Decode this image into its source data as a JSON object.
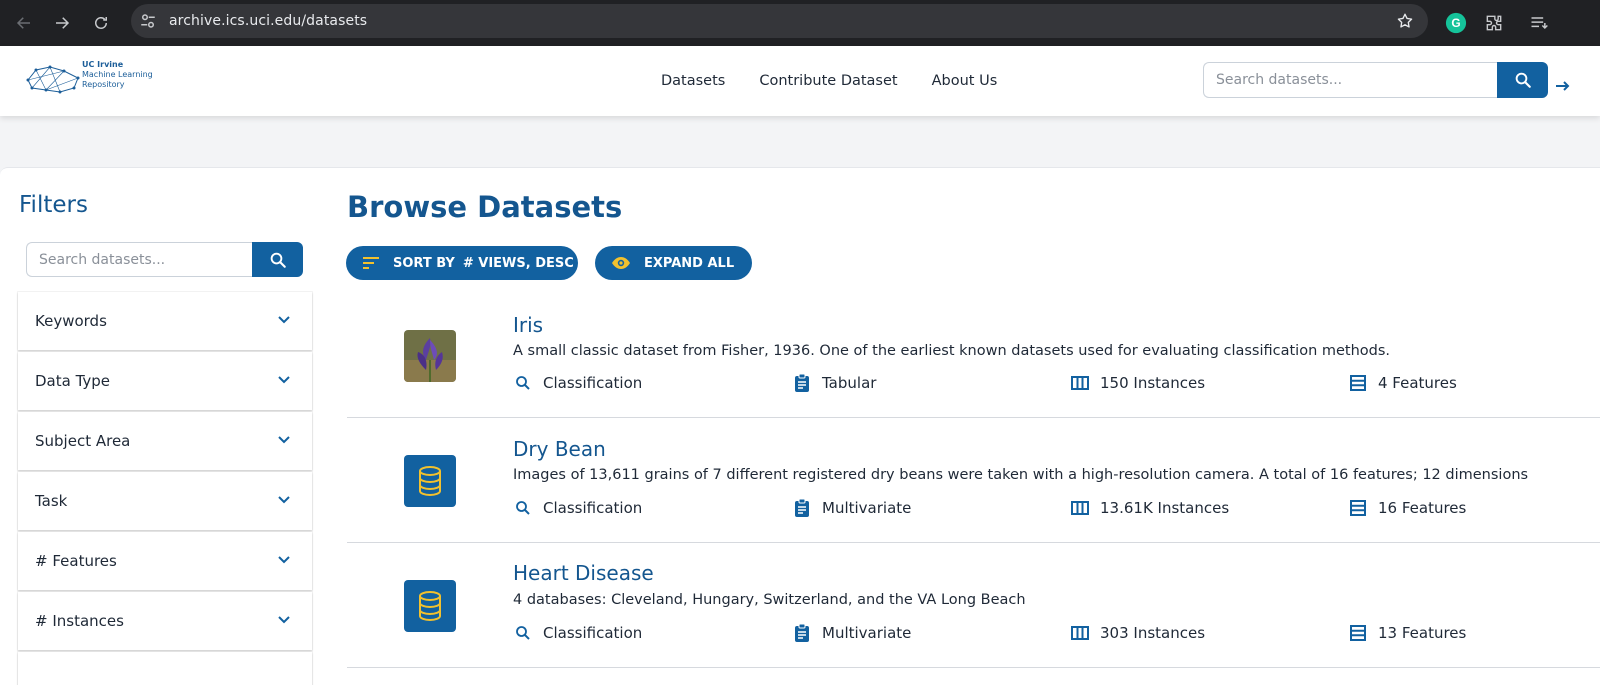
{
  "browser": {
    "url": "archive.ics.uci.edu/datasets"
  },
  "header": {
    "logo": {
      "line1": "UC Irvine",
      "line2": "Machine Learning",
      "line3": "Repository"
    },
    "nav": [
      "Datasets",
      "Contribute Dataset",
      "About Us"
    ],
    "search_placeholder": "Search datasets..."
  },
  "filters": {
    "title": "Filters",
    "search_placeholder": "Search datasets...",
    "items": [
      "Keywords",
      "Data Type",
      "Subject Area",
      "Task",
      "# Features",
      "# Instances"
    ]
  },
  "main": {
    "title": "Browse Datasets",
    "sort_label": "SORT BY",
    "sort_value": "# VIEWS, DESC",
    "expand_label": "EXPAND ALL"
  },
  "datasets": [
    {
      "name": "Iris",
      "description": "A small classic dataset from Fisher, 1936. One of the earliest known datasets used for evaluating classification methods.",
      "task": "Classification",
      "type": "Tabular",
      "instances": "150 Instances",
      "features": "4 Features",
      "thumb": "iris-photo"
    },
    {
      "name": "Dry Bean",
      "description": "Images of 13,611 grains of 7 different registered dry beans were taken with a high-resolution camera. A total of 16 features; 12 dimensions",
      "task": "Classification",
      "type": "Multivariate",
      "instances": "13.61K Instances",
      "features": "16 Features",
      "thumb": "database-icon"
    },
    {
      "name": "Heart Disease",
      "description": "4 databases: Cleveland, Hungary, Switzerland, and the VA Long Beach",
      "task": "Classification",
      "type": "Multivariate",
      "instances": "303 Instances",
      "features": "13 Features",
      "thumb": "database-icon"
    }
  ],
  "colors": {
    "brand": "#1261a0",
    "title": "#14568f",
    "accent_yellow": "#f2c12e"
  }
}
